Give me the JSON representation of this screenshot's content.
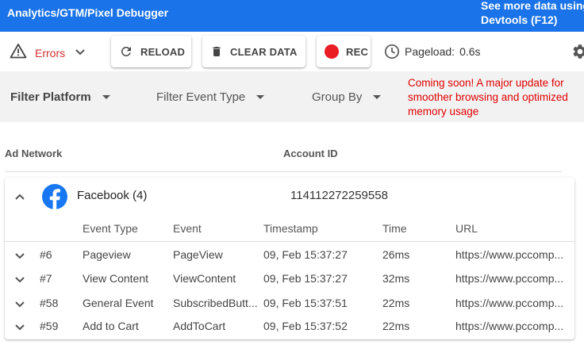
{
  "topbar": {
    "title": "Analytics/GTM/Pixel Debugger",
    "more_line1": "See more data using",
    "more_line2": "Devtools (F12)"
  },
  "toolbar": {
    "errors_label": "Errors",
    "reload_label": "RELOAD",
    "clear_label": "CLEAR DATA",
    "rec_label": "REC",
    "pageload_label": "Pageload:",
    "pageload_value": "0.6s"
  },
  "filters": {
    "platform": "Filter Platform",
    "event_type": "Filter Event Type",
    "group_by": "Group By"
  },
  "notice": "Coming soon! A major update for smoother browsing and optimized memory usage",
  "network_header": {
    "ad_network": "Ad Network",
    "account_id": "Account ID"
  },
  "network": {
    "name": "Facebook (4)",
    "account_id": "114112272259558",
    "columns": {
      "event_type": "Event Type",
      "event": "Event",
      "timestamp": "Timestamp",
      "time": "Time",
      "url": "URL"
    },
    "rows": [
      {
        "num": "#6",
        "type": "Pageview",
        "event": "PageView",
        "timestamp": "09, Feb 15:37:27",
        "time": "26ms",
        "url": "https://www.pccomp..."
      },
      {
        "num": "#7",
        "type": "View Content",
        "event": "ViewContent",
        "timestamp": "09, Feb 15:37:27",
        "time": "32ms",
        "url": "https://www.pccomp..."
      },
      {
        "num": "#58",
        "type": "General Event",
        "event": "SubscribedButt...",
        "timestamp": "09, Feb 15:37:51",
        "time": "22ms",
        "url": "https://www.pccomp..."
      },
      {
        "num": "#59",
        "type": "Add to Cart",
        "event": "AddToCart",
        "timestamp": "09, Feb 15:37:52",
        "time": "22ms",
        "url": "https://www.pccomp..."
      }
    ]
  },
  "colors": {
    "brand_blue": "#1a73e8",
    "error_red": "#d32f2f",
    "rec_red": "#ea1c24",
    "facebook_blue": "#1877f2"
  }
}
